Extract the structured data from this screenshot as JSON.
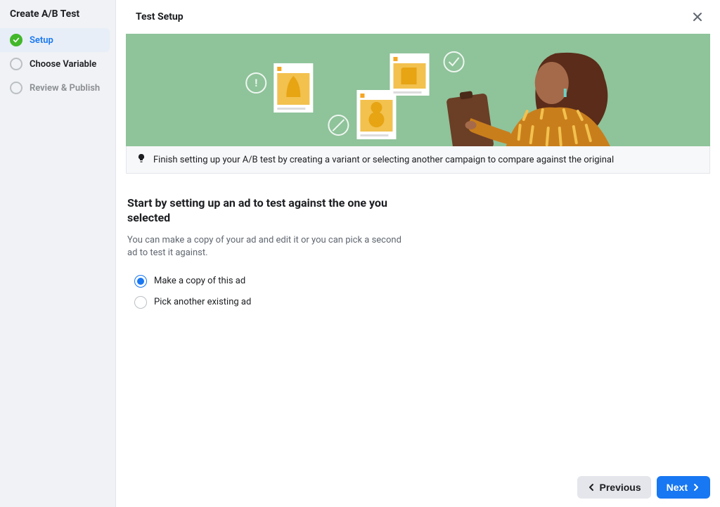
{
  "sidebar": {
    "title": "Create A/B Test",
    "steps": [
      {
        "label": "Setup",
        "state": "active"
      },
      {
        "label": "Choose Variable",
        "state": "default"
      },
      {
        "label": "Review & Publish",
        "state": "disabled"
      }
    ]
  },
  "main": {
    "title": "Test Setup",
    "hint": "Finish setting up your A/B test by creating a variant or selecting another campaign to compare against the original",
    "heading": "Start by setting up an ad to test against the one you selected",
    "description": "You can make a copy of your ad and edit it or you can pick a second ad to test it against.",
    "options": [
      {
        "label": "Make a copy of this ad",
        "selected": true
      },
      {
        "label": "Pick another existing ad",
        "selected": false
      }
    ]
  },
  "footer": {
    "prev": "Previous",
    "next": "Next"
  }
}
